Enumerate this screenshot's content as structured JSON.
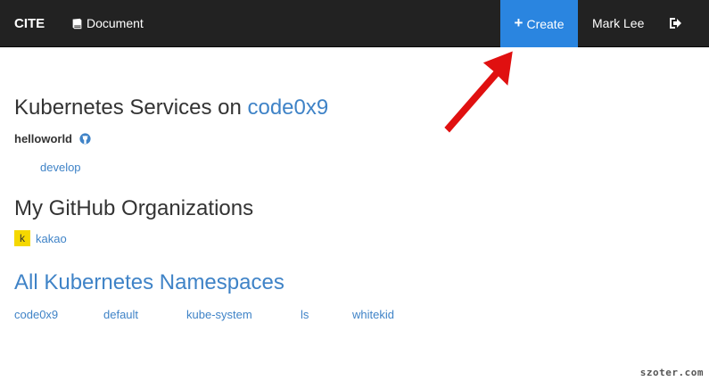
{
  "navbar": {
    "brand": "CITE",
    "document_label": "Document",
    "document_icon": "book-icon",
    "create_label": "Create",
    "create_icon": "plus-icon",
    "user_name": "Mark Lee",
    "logout_icon": "sign-out-icon"
  },
  "services": {
    "heading_prefix": "Kubernetes Services on ",
    "org": "code0x9",
    "repo": "helloworld",
    "repo_icon": "github-icon",
    "branch": "develop"
  },
  "orgs": {
    "heading": "My GitHub Organizations",
    "items": [
      {
        "badge": "k",
        "name": "kakao"
      }
    ]
  },
  "namespaces": {
    "heading": "All Kubernetes Namespaces",
    "items": [
      "code0x9",
      "default",
      "kube-system",
      "ls",
      "whitekid"
    ]
  },
  "watermark": "szoter.com",
  "colors": {
    "navbar_bg": "#222222",
    "create_bg": "#2a85e0",
    "link": "#3f83c7",
    "badge": "#f5d800",
    "annotation_arrow": "#e01010"
  }
}
